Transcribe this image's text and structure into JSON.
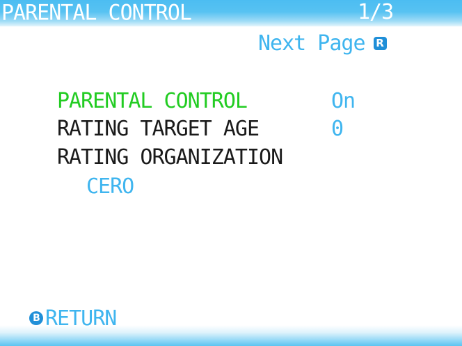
{
  "header": {
    "title": "PARENTAL CONTROL",
    "page_indicator": "1/3"
  },
  "next_page": {
    "label": "Next Page",
    "button_glyph": "R"
  },
  "settings": [
    {
      "label": "PARENTAL CONTROL",
      "value": "On",
      "label_color": "#22cc22"
    },
    {
      "label": "RATING TARGET AGE",
      "value": "0",
      "label_color": "#1a1a1a"
    },
    {
      "label": "RATING ORGANIZATION",
      "value": "CERO",
      "label_color": "#1a1a1a"
    }
  ],
  "footer": {
    "return_label": "RETURN",
    "button_glyph": "B"
  },
  "colors": {
    "accent_blue": "#3fb5ef",
    "selected_green": "#22cc22",
    "button_blue": "#1f8fd8"
  }
}
